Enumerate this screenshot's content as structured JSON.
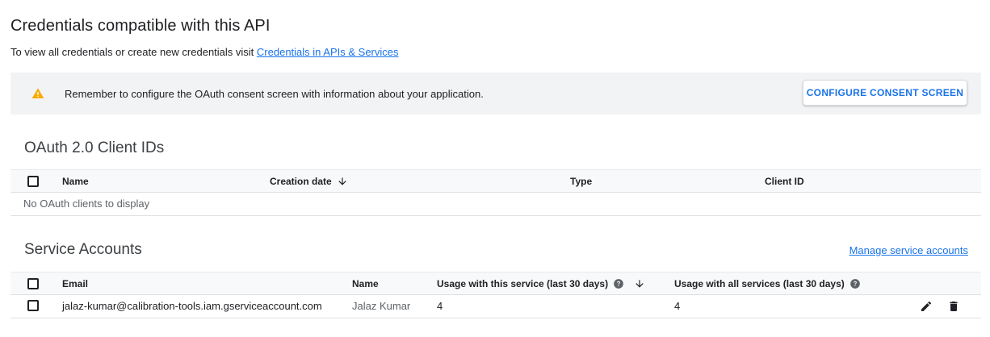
{
  "header": {
    "title": "Credentials compatible with this API",
    "subtitle_prefix": "To view all credentials or create new credentials visit ",
    "subtitle_link": "Credentials in APIs & Services"
  },
  "banner": {
    "icon": "warning-icon",
    "message": "Remember to configure the OAuth consent screen with information about your application.",
    "button_label": "CONFIGURE CONSENT SCREEN"
  },
  "oauth": {
    "title": "OAuth 2.0 Client IDs",
    "columns": {
      "name": "Name",
      "creation_date": "Creation date",
      "type": "Type",
      "client_id": "Client ID"
    },
    "empty_message": "No OAuth clients to display"
  },
  "service_accounts": {
    "title": "Service Accounts",
    "manage_link": "Manage service accounts",
    "columns": {
      "email": "Email",
      "name": "Name",
      "usage_service": "Usage with this service (last 30 days)",
      "usage_all": "Usage with all services (last 30 days)"
    },
    "rows": [
      {
        "email": "jalaz-kumar@calibration-tools.iam.gserviceaccount.com",
        "name": "Jalaz Kumar",
        "usage_service": "4",
        "usage_all": "4"
      }
    ]
  },
  "colors": {
    "accent": "#1a73e8",
    "warning": "#f9ab00",
    "banner_bg": "#f1f3f4"
  }
}
